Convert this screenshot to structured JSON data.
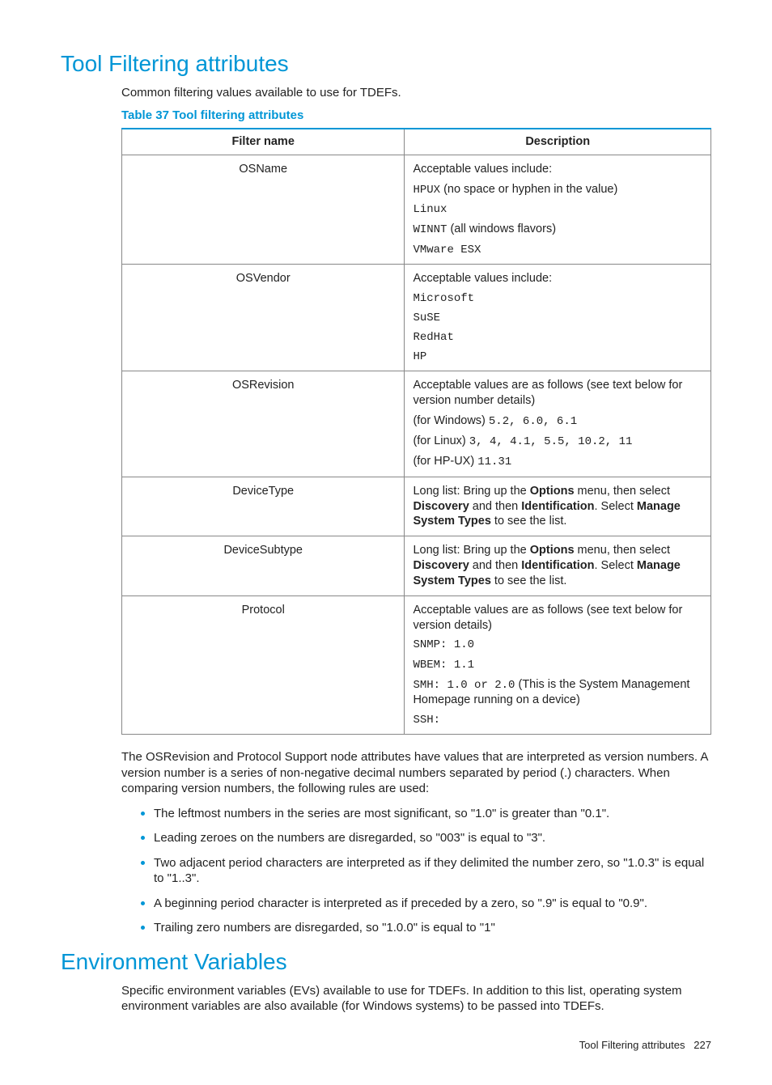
{
  "section1_title": "Tool Filtering attributes",
  "section1_intro": "Common filtering values available to use for TDEFs.",
  "table_caption": "Table 37 Tool filtering attributes",
  "columns": {
    "name": "Filter name",
    "desc": "Description"
  },
  "rows": {
    "osname": {
      "name": "OSName",
      "p1": "Acceptable values include:",
      "p2a": "HPUX",
      "p2b": " (no space or hyphen in the value)",
      "p3": "Linux",
      "p4a": "WINNT",
      "p4b": " (all windows flavors)",
      "p5": "VMware ESX"
    },
    "osvendor": {
      "name": "OSVendor",
      "p1": "Acceptable values include:",
      "p2": "Microsoft",
      "p3": "SuSE",
      "p4": "RedHat",
      "p5": "HP"
    },
    "osrevision": {
      "name": "OSRevision",
      "p1": "Acceptable values are as follows (see text below for version number details)",
      "p2a": "(for Windows) ",
      "p2b": "5.2, 6.0, 6.1",
      "p3a": "(for Linux) ",
      "p3b": "3, 4, 4.1, 5.5, 10.2, 11",
      "p4a": "(for HP-UX) ",
      "p4b": "11.31"
    },
    "devicetype": {
      "name": "DeviceType",
      "t1": "Long list: Bring up the ",
      "b1": "Options",
      "t2": " menu, then select ",
      "b2": "Discovery",
      "t3": " and then ",
      "b3": "Identification",
      "t4": ". Select ",
      "b4": "Manage System Types",
      "t5": " to see the list."
    },
    "devicesubtype": {
      "name": "DeviceSubtype",
      "t1": "Long list: Bring up the ",
      "b1": "Options",
      "t2": " menu, then select ",
      "b2": "Discovery",
      "t3": " and then ",
      "b3": "Identification",
      "t4": ". Select ",
      "b4": "Manage System Types",
      "t5": " to see the list."
    },
    "protocol": {
      "name": "Protocol",
      "p1": "Acceptable values are as follows (see text below for version details)",
      "p2": "SNMP: 1.0",
      "p3": "WBEM: 1.1",
      "p4a": "SMH: 1.0 or 2.0",
      "p4b": " (This is the System Management Homepage running on a device)",
      "p5": "SSH:"
    }
  },
  "para_after_table": "The OSRevision and Protocol Support node attributes have values that are interpreted as version numbers. A version number is a series of non-negative decimal numbers separated by period (.) characters. When comparing version numbers, the following rules are used:",
  "bullets": [
    "The leftmost numbers in the series are most significant, so \"1.0\" is greater than \"0.1\".",
    "Leading zeroes on the numbers are disregarded, so \"003\" is equal to \"3\".",
    "Two adjacent period characters are interpreted as if they delimited the number zero, so \"1.0.3\" is equal to \"1..3\".",
    "A beginning period character is interpreted as if preceded by a zero, so \".9\" is equal to \"0.9\".",
    "Trailing zero numbers are disregarded, so \"1.0.0\" is equal to \"1\""
  ],
  "section2_title": "Environment Variables",
  "section2_intro": "Specific environment variables (EVs) available to use for TDEFs. In addition to this list, operating system environment variables are also available (for Windows systems) to be passed into TDEFs.",
  "footer_text": "Tool Filtering attributes",
  "footer_page": "227"
}
